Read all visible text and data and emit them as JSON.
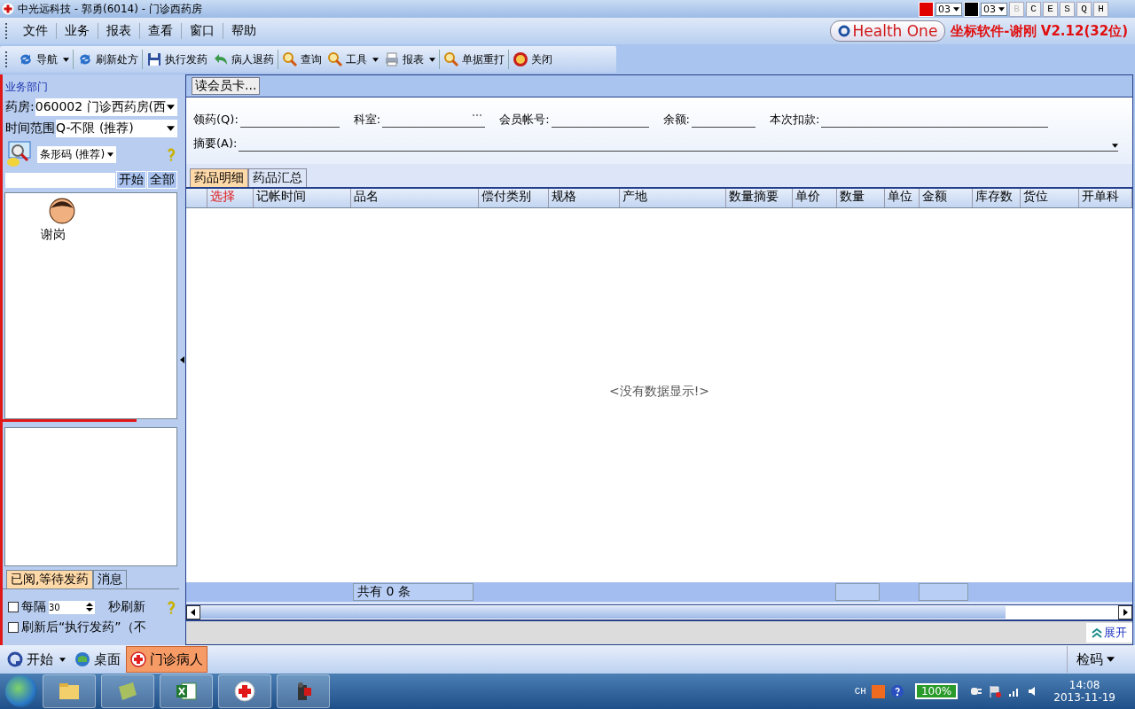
{
  "window": {
    "title": "中光远科技 - 郭勇(6014) - 门诊西药房"
  },
  "style_bar": {
    "pickers": [
      {
        "color": "#e00000",
        "value": "03"
      },
      {
        "color": "#000000",
        "value": "03"
      }
    ],
    "letters": [
      {
        "label": "B",
        "disabled": true
      },
      {
        "label": "C",
        "disabled": false
      },
      {
        "label": "E",
        "disabled": false
      },
      {
        "label": "S",
        "disabled": false
      },
      {
        "label": "Q",
        "disabled": false
      },
      {
        "label": "H",
        "disabled": false
      }
    ]
  },
  "menu": [
    "文件",
    "业务",
    "报表",
    "查看",
    "窗口",
    "帮助"
  ],
  "brand": {
    "logo": "Health One",
    "version": "坐标软件-谢刚 V2.12(32位)"
  },
  "toolbar": [
    {
      "label": "导航",
      "kind": "refresh",
      "dropdown": true
    },
    {
      "label": "刷新处方",
      "kind": "refresh",
      "dropdown": false
    },
    {
      "label": "执行发药",
      "kind": "save",
      "dropdown": false
    },
    {
      "label": "病人退药",
      "kind": "return",
      "dropdown": false
    },
    {
      "label": "查询",
      "kind": "search",
      "dropdown": false
    },
    {
      "label": "工具",
      "kind": "search",
      "dropdown": true
    },
    {
      "label": "报表",
      "kind": "printer",
      "dropdown": true
    },
    {
      "label": "单据重打",
      "kind": "search",
      "dropdown": false
    },
    {
      "label": "关闭",
      "kind": "close",
      "dropdown": false
    }
  ],
  "left_panel": {
    "section": "业务部门",
    "pharmacy": {
      "label": "药房:",
      "value": "060002 门诊西药房(西"
    },
    "time_range": {
      "label": "时间范围",
      "value": "Q-不限 (推荐)"
    },
    "search_mode": "条形码 (推荐)",
    "buttons": [
      "开始",
      "全部"
    ],
    "users": [
      {
        "name": "谢岗"
      }
    ],
    "tabs": [
      {
        "label": "已阅,等待发药",
        "selected": true
      },
      {
        "label": "消息",
        "selected": false
      }
    ],
    "refresh": {
      "checked": false,
      "prefix": "每隔",
      "value": "30",
      "suffix": "秒刷新"
    },
    "auto_dispense": {
      "checked": false,
      "label": "刷新后“执行发药”（不"
    }
  },
  "main": {
    "card_button": "读会员卡...",
    "fields": [
      {
        "label": "领药(Q):"
      },
      {
        "label": "科室:",
        "kind": "lookup"
      },
      {
        "label": "会员帐号:"
      },
      {
        "label": "余额:"
      },
      {
        "label": "本次扣款:"
      }
    ],
    "summary": {
      "label": "摘要(A):"
    },
    "tabs": [
      {
        "label": "药品明细",
        "selected": true
      },
      {
        "label": "药品汇总",
        "selected": false
      }
    ],
    "columns": [
      {
        "label": "选择",
        "highlighted": true
      },
      {
        "label": "记帐时间",
        "highlighted": false
      },
      {
        "label": "品名",
        "highlighted": false
      },
      {
        "label": "偿付类别",
        "highlighted": false
      },
      {
        "label": "规格",
        "highlighted": false
      },
      {
        "label": "产地",
        "highlighted": false
      },
      {
        "label": "数量摘要",
        "highlighted": false
      },
      {
        "label": "单价",
        "highlighted": false
      },
      {
        "label": "数量",
        "highlighted": false
      },
      {
        "label": "单位",
        "highlighted": false
      },
      {
        "label": "金额",
        "highlighted": false
      },
      {
        "label": "库存数",
        "highlighted": false
      },
      {
        "label": "货位",
        "highlighted": false
      },
      {
        "label": "开单科",
        "highlighted": false
      }
    ],
    "empty_message": "<没有数据显示!>",
    "footer_count": "共有 0 条",
    "expand_link": "展开"
  },
  "app_bar": {
    "items": [
      {
        "label": "开始",
        "kind": "start",
        "selected": false
      },
      {
        "label": "桌面",
        "kind": "desktop",
        "selected": false
      },
      {
        "label": "门诊病人",
        "kind": "patient",
        "selected": true
      }
    ],
    "right": "检码"
  },
  "taskbar": {
    "language": "CH",
    "battery": "100%",
    "time": "14:08",
    "date": "2013-11-19"
  }
}
